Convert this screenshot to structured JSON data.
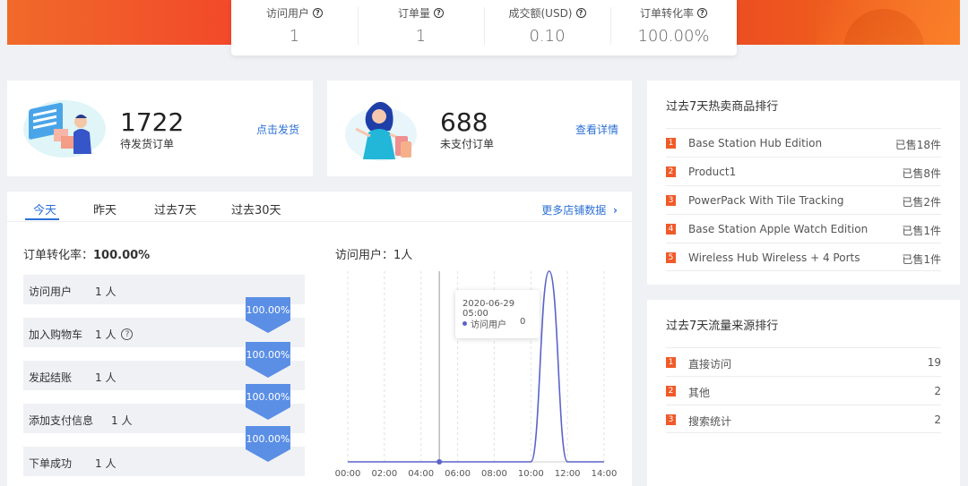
{
  "stats": [
    {
      "label": "访问用户",
      "value": "1"
    },
    {
      "label": "订单量",
      "value": "1"
    },
    {
      "label": "成交额(USD)",
      "value": "0.10"
    },
    {
      "label": "订单转化率",
      "value": "100.00%"
    }
  ],
  "pending_orders": {
    "count": "1722",
    "label": "待发货订单",
    "link": "点击发货"
  },
  "unpaid_orders": {
    "count": "688",
    "label": "未支付订单",
    "link": "查看详情"
  },
  "tabs": [
    "今天",
    "昨天",
    "过去7天",
    "过去30天"
  ],
  "more_link": "更多店铺数据",
  "conversion": {
    "title": "订单转化率：",
    "rate": "100.00%",
    "steps": [
      {
        "name": "访问用户",
        "count": "1 人"
      },
      {
        "name": "加入购物车",
        "count": "1 人"
      },
      {
        "name": "发起结账",
        "count": "1 人"
      },
      {
        "name": "添加支付信息",
        "count": "1 人"
      },
      {
        "name": "下单成功",
        "count": "1 人"
      }
    ],
    "step_rates": [
      "100.00%",
      "100.00%",
      "100.00%",
      "100.00%"
    ]
  },
  "visitors": {
    "title": "访问用户：",
    "value": "1人"
  },
  "tooltip": {
    "time": "2020-06-29 05:00",
    "series": "访问用户",
    "value": "0"
  },
  "chart_data": {
    "type": "line",
    "x": [
      "00:00",
      "01:00",
      "02:00",
      "03:00",
      "04:00",
      "05:00",
      "06:00",
      "07:00",
      "08:00",
      "09:00",
      "10:00",
      "11:00",
      "12:00",
      "13:00",
      "14:00"
    ],
    "tick_labels": [
      "00:00",
      "02:00",
      "04:00",
      "06:00",
      "08:00",
      "10:00",
      "12:00",
      "14:00"
    ],
    "series": [
      {
        "name": "访问用户",
        "values": [
          0,
          0,
          0,
          0,
          0,
          0,
          0,
          0,
          0,
          0,
          0,
          1,
          0,
          0,
          0
        ]
      }
    ],
    "ylim": [
      0,
      1
    ],
    "color": "#5b63c9",
    "grid": "vertical dashed"
  },
  "hot_products": {
    "title": "过去7天热卖商品排行",
    "items": [
      {
        "rank": "1",
        "name": "Base Station Hub Edition",
        "sold": "已售18件"
      },
      {
        "rank": "2",
        "name": "Product1",
        "sold": "已售8件"
      },
      {
        "rank": "3",
        "name": "PowerPack With Tile Tracking",
        "sold": "已售2件"
      },
      {
        "rank": "4",
        "name": "Base Station Apple Watch Edition",
        "sold": "已售1件"
      },
      {
        "rank": "5",
        "name": "Wireless Hub Wireless + 4 Ports",
        "sold": "已售1件"
      }
    ]
  },
  "traffic_sources": {
    "title": "过去7天流量来源排行",
    "items": [
      {
        "rank": "1",
        "name": "直接访问",
        "value": "19"
      },
      {
        "rank": "2",
        "name": "其他",
        "value": "2"
      },
      {
        "rank": "3",
        "name": "搜索统计",
        "value": "2"
      }
    ]
  },
  "colors": {
    "accent": "#2b6fd6",
    "rank_badge": "#f05a28",
    "funnel_arrow": "#5b8fe6"
  }
}
